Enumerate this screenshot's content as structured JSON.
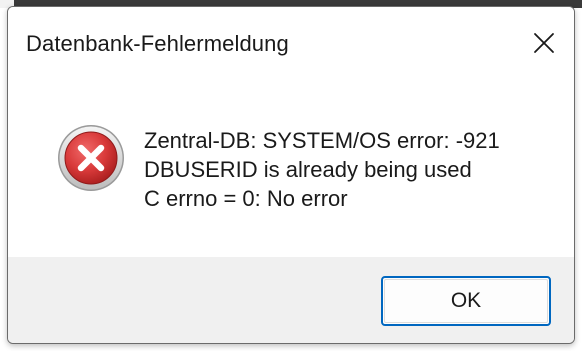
{
  "dialog": {
    "title": "Datenbank-Fehlermeldung",
    "close_icon": "close-icon",
    "icon": "error-icon",
    "message_lines": [
      "Zentral-DB: SYSTEM/OS error: -921",
      "DBUSERID is already being used",
      "C errno = 0: No error"
    ],
    "ok_label": "OK"
  },
  "colors": {
    "accent": "#0067c0",
    "error_red": "#d93a3a",
    "footer_bg": "#f0f0f0"
  }
}
